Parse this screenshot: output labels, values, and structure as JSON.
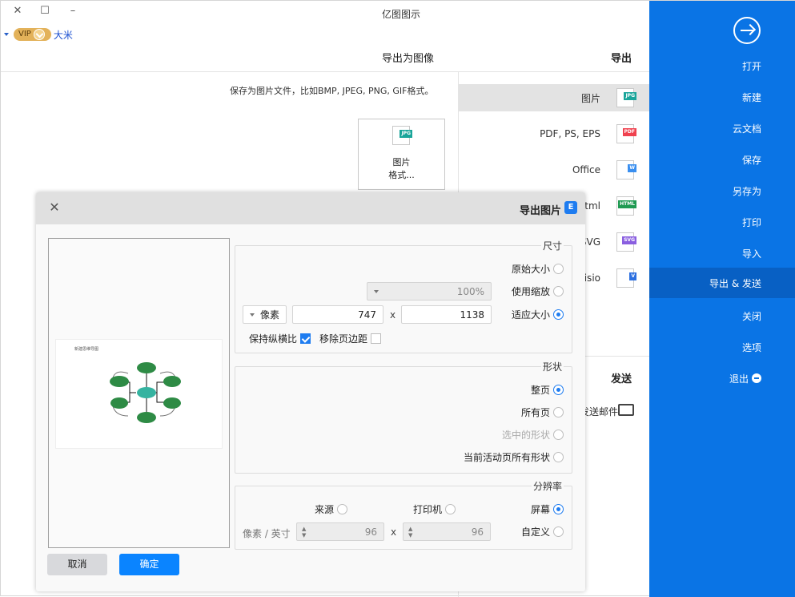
{
  "window": {
    "title": "亿图图示",
    "controls": {
      "close": "✕",
      "maximize": "☐",
      "minimize": "–"
    }
  },
  "user": {
    "name": "大米",
    "badge": "VIP"
  },
  "panel": {
    "title": "导出为图像",
    "section_title": "导出"
  },
  "description": "保存为图片文件，比如BMP, JPEG, PNG, GIF格式。",
  "image_card": {
    "label_line1": "图片",
    "label_line2": "格式..."
  },
  "formats": [
    {
      "label": "图片",
      "tag": "JPG",
      "color": "#1aa59a",
      "selected": true
    },
    {
      "label": "PDF, PS, EPS",
      "tag": "PDF",
      "color": "#f0424f",
      "selected": false
    },
    {
      "label": "Office",
      "tag": "W",
      "color": "#3a8ff0",
      "selected": false
    },
    {
      "label": "Html",
      "tag": "HTML",
      "color": "#1f9a52",
      "selected": false
    },
    {
      "label": "SVG",
      "tag": "SVG",
      "color": "#8a5fe0",
      "selected": false
    },
    {
      "label": "Visio",
      "tag": "V",
      "color": "#2c6fe0",
      "selected": false
    }
  ],
  "send": {
    "title": "发送",
    "item": "发送邮件"
  },
  "sidebar": {
    "accent": "#0a74e5",
    "items": [
      {
        "label": "打开"
      },
      {
        "label": "新建"
      },
      {
        "label": "云文档"
      },
      {
        "label": "保存"
      },
      {
        "label": "另存为"
      },
      {
        "label": "打印"
      },
      {
        "label": "导入"
      },
      {
        "label": "导出 & 发送",
        "active": true
      },
      {
        "label": "关闭"
      },
      {
        "label": "选项"
      },
      {
        "label": "退出"
      }
    ]
  },
  "dialog": {
    "title": "导出图片",
    "size": {
      "legend": "尺寸",
      "options": [
        "原始大小",
        "使用缩放",
        "适应大小"
      ],
      "selected": "适应大小",
      "zoom_value": "100%",
      "width": "1138",
      "height": "747",
      "times": "x",
      "unit": "像素",
      "remove_margin": {
        "label": "移除页边距",
        "checked": false
      },
      "keep_ratio": {
        "label": "保持纵横比",
        "checked": true
      }
    },
    "shape": {
      "legend": "形状",
      "options": [
        "整页",
        "所有页",
        "选中的形状",
        "当前活动页所有形状"
      ],
      "selected": "整页",
      "disabled": [
        "选中的形状"
      ]
    },
    "resolution": {
      "legend": "分辨率",
      "options": [
        "屏幕",
        "打印机",
        "来源",
        "自定义"
      ],
      "selected": "屏幕",
      "dpi_x": "96",
      "dpi_y": "96",
      "times": "x",
      "unit": "像素 / 英寸"
    },
    "preview": {
      "diagram_title": "新建思维导图"
    },
    "buttons": {
      "ok": "确定",
      "cancel": "取消"
    }
  }
}
